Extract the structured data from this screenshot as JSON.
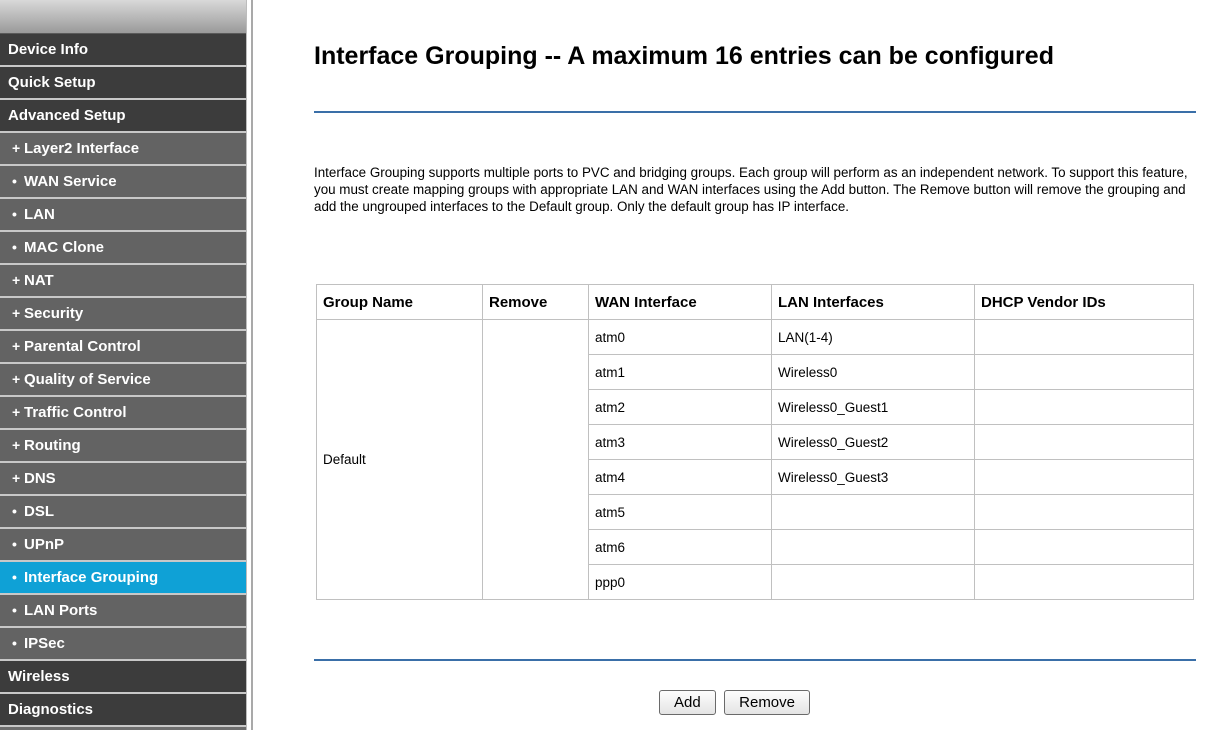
{
  "sidebar": {
    "items": [
      {
        "label": "Device Info",
        "type": "main",
        "active": false
      },
      {
        "label": "Quick Setup",
        "type": "main",
        "active": false
      },
      {
        "label": "Advanced Setup",
        "type": "main",
        "active": false
      },
      {
        "label": "Layer2 Interface",
        "type": "sub",
        "bullet": "+",
        "active": false
      },
      {
        "label": "WAN Service",
        "type": "sub",
        "bullet": "•",
        "active": false
      },
      {
        "label": "LAN",
        "type": "sub",
        "bullet": "•",
        "active": false
      },
      {
        "label": "MAC Clone",
        "type": "sub",
        "bullet": "•",
        "active": false
      },
      {
        "label": "NAT",
        "type": "sub",
        "bullet": "+",
        "active": false
      },
      {
        "label": "Security",
        "type": "sub",
        "bullet": "+",
        "active": false
      },
      {
        "label": "Parental Control",
        "type": "sub",
        "bullet": "+",
        "active": false
      },
      {
        "label": "Quality of Service",
        "type": "sub",
        "bullet": "+",
        "active": false
      },
      {
        "label": "Traffic Control",
        "type": "sub",
        "bullet": "+",
        "active": false
      },
      {
        "label": "Routing",
        "type": "sub",
        "bullet": "+",
        "active": false
      },
      {
        "label": "DNS",
        "type": "sub",
        "bullet": "+",
        "active": false
      },
      {
        "label": "DSL",
        "type": "sub",
        "bullet": "•",
        "active": false
      },
      {
        "label": "UPnP",
        "type": "sub",
        "bullet": "•",
        "active": false
      },
      {
        "label": "Interface Grouping",
        "type": "sub",
        "bullet": "•",
        "active": true
      },
      {
        "label": "LAN Ports",
        "type": "sub",
        "bullet": "•",
        "active": false
      },
      {
        "label": "IPSec",
        "type": "sub",
        "bullet": "•",
        "active": false
      },
      {
        "label": "Wireless",
        "type": "main",
        "active": false
      },
      {
        "label": "Diagnostics",
        "type": "main",
        "active": false
      }
    ]
  },
  "main": {
    "title": "Interface Grouping -- A maximum 16 entries can be configured",
    "description": "Interface Grouping supports multiple ports to PVC and bridging groups. Each group will perform as an independent network. To support this feature, you must create mapping groups with appropriate LAN and WAN interfaces using the Add button. The Remove button will remove the grouping and add the ungrouped interfaces to the Default group. Only the default group has IP interface.",
    "table": {
      "headers": [
        "Group Name",
        "Remove",
        "WAN Interface",
        "LAN Interfaces",
        "DHCP Vendor IDs"
      ],
      "group_name": "Default",
      "rows": [
        {
          "wan": "atm0",
          "lan": "LAN(1-4)",
          "dhcp": ""
        },
        {
          "wan": "atm1",
          "lan": "Wireless0",
          "dhcp": ""
        },
        {
          "wan": "atm2",
          "lan": "Wireless0_Guest1",
          "dhcp": ""
        },
        {
          "wan": "atm3",
          "lan": "Wireless0_Guest2",
          "dhcp": ""
        },
        {
          "wan": "atm4",
          "lan": "Wireless0_Guest3",
          "dhcp": ""
        },
        {
          "wan": "atm5",
          "lan": "",
          "dhcp": ""
        },
        {
          "wan": "atm6",
          "lan": "",
          "dhcp": ""
        },
        {
          "wan": "ppp0",
          "lan": "",
          "dhcp": ""
        }
      ]
    },
    "buttons": {
      "add": "Add",
      "remove": "Remove"
    }
  },
  "colors": {
    "sidebar_main": "#3c3c3c",
    "sidebar_sub": "#636363",
    "sidebar_active": "#0fa1d6",
    "rule_line": "#3a6fa8"
  }
}
